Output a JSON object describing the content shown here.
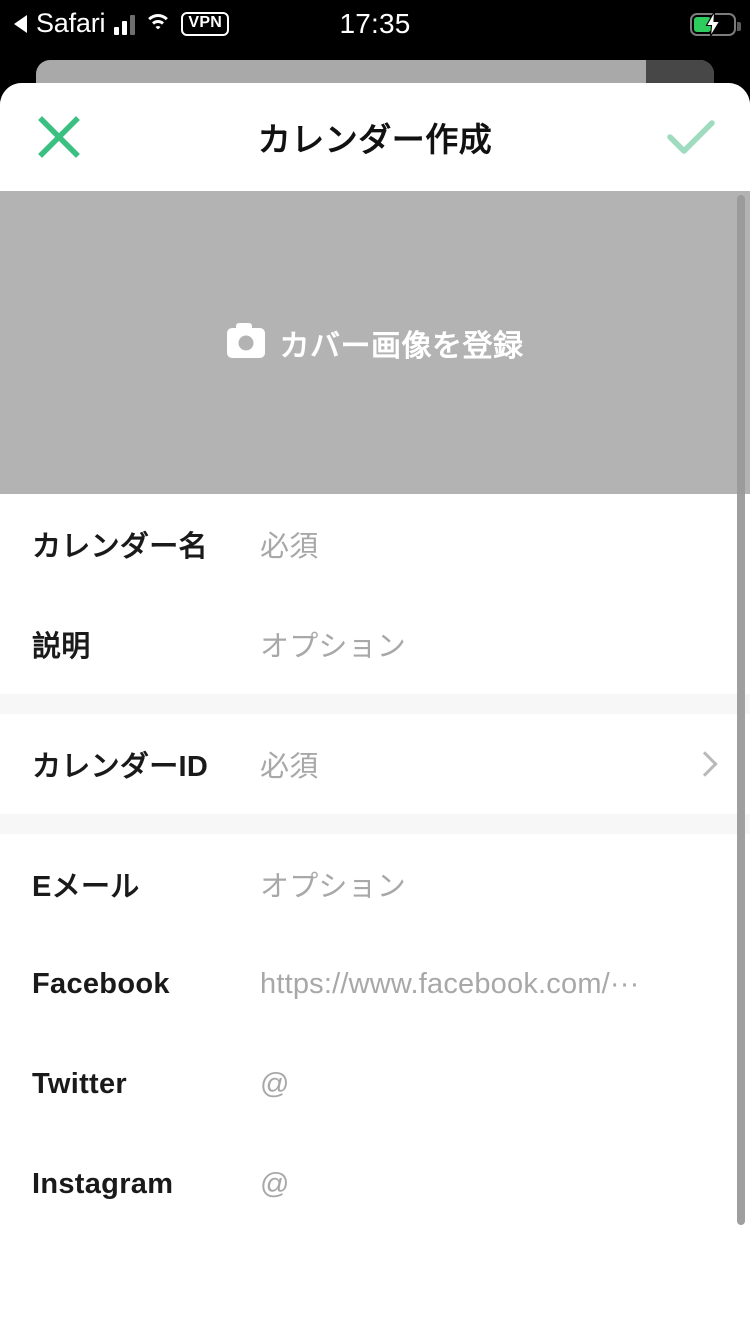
{
  "status_bar": {
    "back_app": "Safari",
    "back_icon": "back-triangle-icon",
    "signal_icon": "cellular-signal-icon",
    "wifi_icon": "wifi-icon",
    "vpn_badge": "VPN",
    "time": "17:35",
    "battery_icon": "battery-charging-icon"
  },
  "header": {
    "title": "カレンダー作成",
    "close_icon": "close-x-icon",
    "confirm_icon": "checkmark-icon",
    "close_color": "#3ac080",
    "confirm_color": "#9edbbf"
  },
  "cover": {
    "label": "カバー画像を登録",
    "camera_icon": "camera-icon",
    "background_color": "#b3b3b3"
  },
  "form": {
    "groups": [
      {
        "rows": [
          {
            "label": "カレンダー名",
            "value": "必須",
            "chevron": false
          },
          {
            "label": "説明",
            "value": "オプション",
            "chevron": false
          }
        ]
      },
      {
        "rows": [
          {
            "label": "カレンダーID",
            "value": "必須",
            "chevron": true
          }
        ]
      },
      {
        "rows": [
          {
            "label": "Eメール",
            "value": "オプション",
            "chevron": false
          },
          {
            "label": "Facebook",
            "value": "https://www.facebook.com/···",
            "chevron": false
          },
          {
            "label": "Twitter",
            "value": "@",
            "chevron": false
          },
          {
            "label": "Instagram",
            "value": "@",
            "chevron": false
          }
        ]
      }
    ]
  }
}
